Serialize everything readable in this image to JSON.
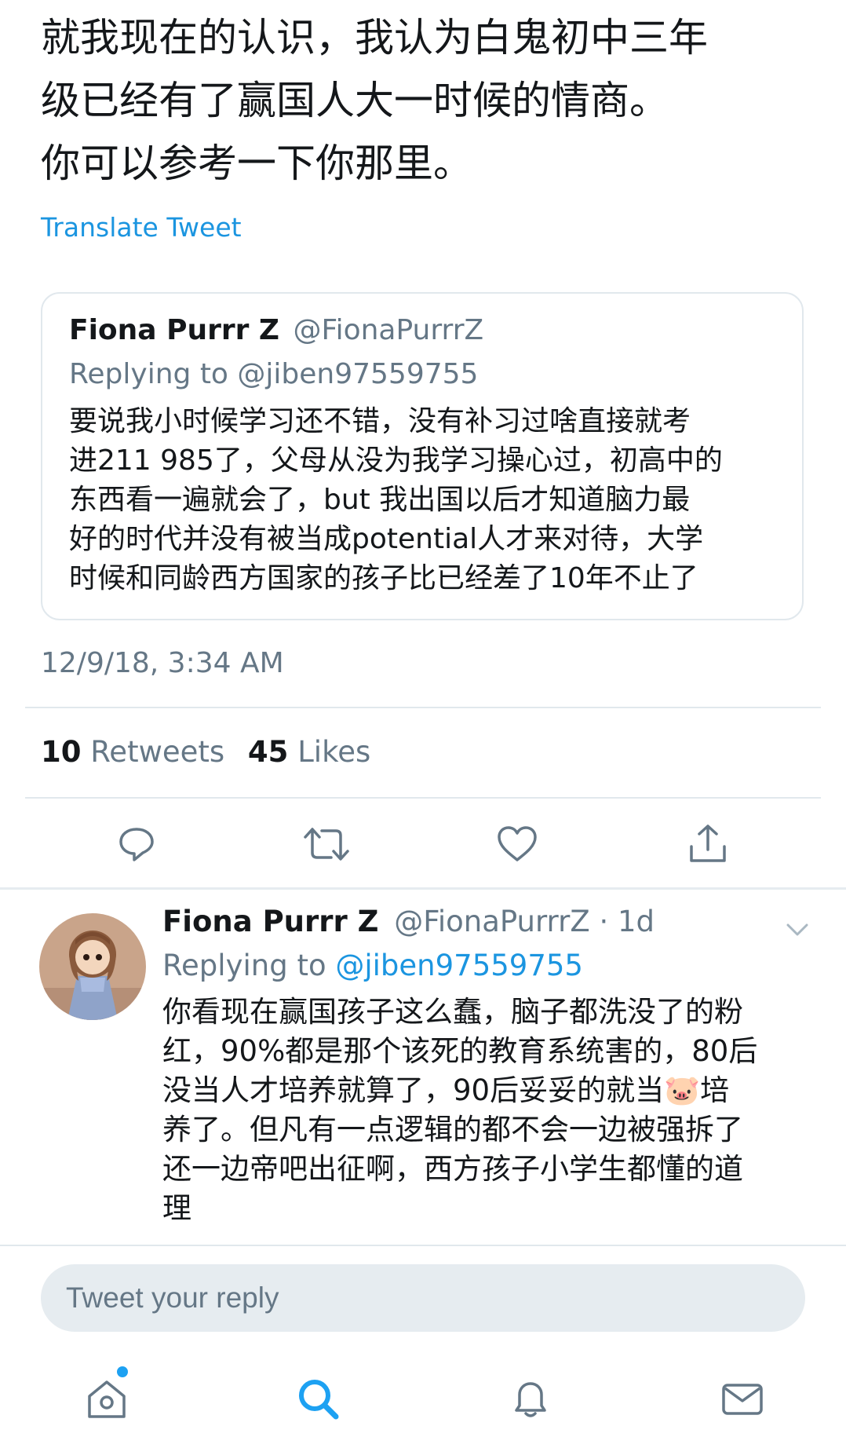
{
  "tweet": {
    "text": "就我现在的认识，我认为白鬼初中三年\n级已经有了赢国人大一时候的情商。\n你可以参考一下你那里。",
    "translate_label": "Translate Tweet",
    "timestamp": "12/9/18, 3:34 AM",
    "retweets_count": "10",
    "retweets_label": "Retweets",
    "likes_count": "45",
    "likes_label": "Likes"
  },
  "quoted_tweet": {
    "name": "Fiona Purrr Z",
    "handle": "@FionaPurrrZ",
    "replying": "Replying to @jiben97559755",
    "text": "要说我小时候学习还不错，没有补习过啥直接就考\n进211 985了，父母从没为我学习操心过，初高中的\n东西看一遍就会了，but 我出国以后才知道脑力最\n好的时代并没有被当成potential人才来对待，大学\n时候和同龄西方国家的孩子比已经差了10年不止了"
  },
  "actions": {
    "icons": [
      "reply-icon",
      "retweet-icon",
      "like-icon",
      "share-icon"
    ]
  },
  "reply": {
    "name": "Fiona Purrr Z",
    "handle": "@FionaPurrrZ",
    "time": " · 1d",
    "replying_prefix": "Replying to ",
    "replying_mention": "@jiben97559755",
    "text": "你看现在赢国孩子这么蠢，脑子都洗没了的粉\n红，90%都是那个该死的教育系统害的，80后\n没当人才培养就算了，90后妥妥的就当🐷培\n养了。但凡有一点逻辑的都不会一边被强拆了\n还一边帝吧出征啊，西方孩子小学生都懂的道\n理"
  },
  "reply_box": {
    "placeholder": "Tweet your reply"
  },
  "tab_bar": {
    "icons": [
      "home-icon",
      "search-icon",
      "notifications-icon",
      "messages-icon"
    ]
  },
  "colors": {
    "accent": "#1da1f2",
    "link": "#1b95e0",
    "secondary_text": "#657786",
    "divider": "#e1e8ed"
  }
}
